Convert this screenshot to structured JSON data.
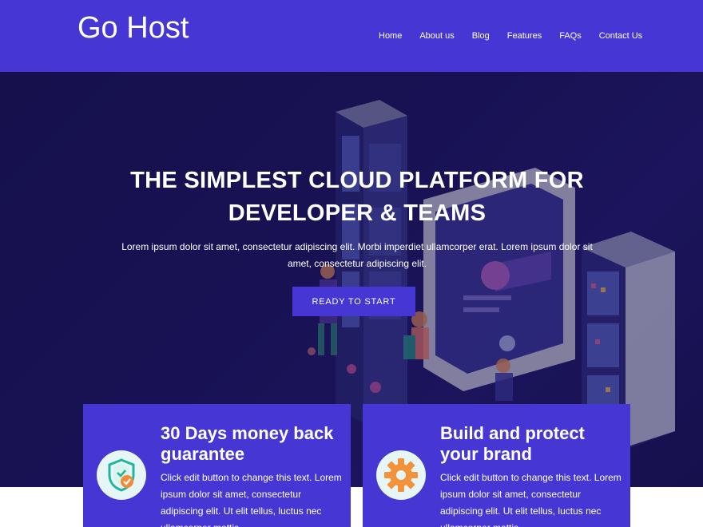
{
  "header": {
    "logo": "Go Host",
    "nav": [
      "Home",
      "About us",
      "Blog",
      "Features",
      "FAQs",
      "Contact Us"
    ]
  },
  "hero": {
    "title": "THE SIMPLEST CLOUD PLATFORM FOR DEVELOPER & TEAMS",
    "text": "Lorem ipsum dolor sit amet, consectetur adipiscing elit. Morbi imperdiet ullamcorper erat. Lorem ipsum dolor sit amet, consectetur adipiscing elit.",
    "cta": "READY TO START"
  },
  "cards": [
    {
      "title": "30 Days money back guarantee",
      "text": "Click edit button to change this text. Lorem ipsum dolor sit amet, consectetur adipiscing elit. Ut elit tellus, luctus nec ullamcorper mattis",
      "icon": "shield-check-icon"
    },
    {
      "title": "Build and protect your brand",
      "text": "Click edit button to change this text. Lorem ipsum dolor sit amet, consectetur adipiscing elit. Ut elit tellus, luctus nec ullamcorper mattis",
      "icon": "gear-icon"
    }
  ],
  "colors": {
    "brand": "#4636d4",
    "hero_bg": "#1c1560",
    "white": "#ffffff"
  }
}
